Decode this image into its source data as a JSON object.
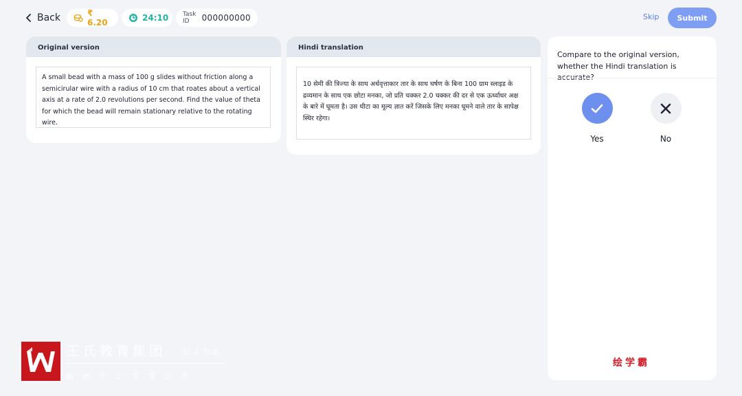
{
  "header": {
    "back_label": "Back",
    "coins": "₹ 6.20",
    "timer": "24:10",
    "task_id_label": "Task ID",
    "task_id_value": "000000000",
    "skip_label": "Skip",
    "submit_label": "Submit"
  },
  "original": {
    "title": "Original version",
    "text": "A small bead with a mass of 100 g slides without friction along a semicirular wire with a radius of 10 cm that roates about a vertical axis at a rate of 2.0 revolutions per second. Find the value of theta for which the bead will remain stationary relative to the rotating wire."
  },
  "hindi": {
    "title": "Hindi translation",
    "text": "10 सेमी की त्रिज्या के साथ अर्धवृत्ताकार तार के साथ घर्षण के बिना 100 ग्राम स्लाइड के द्रव्यमान के साथ एक छोटा मनका, जो प्रति चक्कर 2.0 चक्कर की दर से एक ऊर्ध्वाधर अक्ष के बारे में घूमता है। उस थीटा का मूल्य ज्ञात करें जिसके लिए मनका घूमने वाले तार के सापेक्ष स्थिर रहेगा।"
  },
  "question": {
    "text": "Compare to the original version, whether the Hindi translation is accurate?",
    "yes_label": "Yes",
    "no_label": "No"
  },
  "watermark": {
    "title": "王氏教育集团",
    "slogan": "以人为本",
    "subtitle": "始创于二零零二年",
    "brand_right": "绘学霸"
  },
  "colors": {
    "accent": "#6d8fee",
    "submit": "#7d9ef2",
    "coin": "#f0a21a",
    "timer": "#22b3a6",
    "brand_red": "#c8161d",
    "background": "#f2f4f8"
  },
  "icons": {
    "back": "chevron-left-icon",
    "coins": "coins-icon",
    "timer": "timer-icon",
    "yes": "checkmark-icon",
    "no": "close-icon"
  }
}
